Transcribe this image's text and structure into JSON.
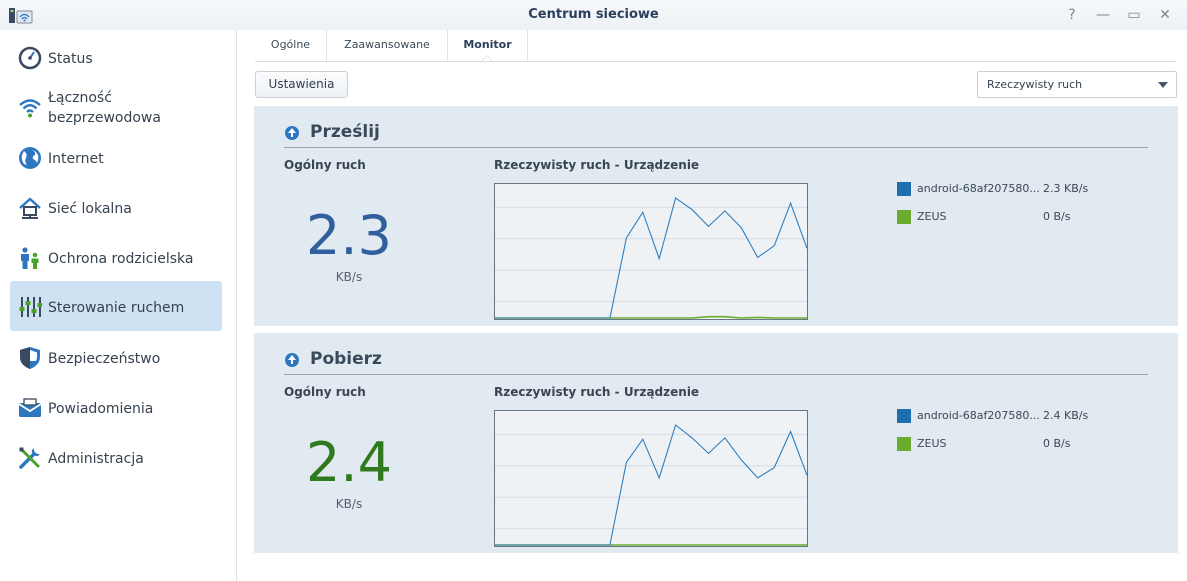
{
  "window": {
    "title": "Centrum sieciowe",
    "help_glyph": "?",
    "minimize_glyph": "—",
    "maximize_glyph": "▭",
    "close_glyph": "✕"
  },
  "sidebar": {
    "items": [
      {
        "label": "Status",
        "icon": "gauge-icon",
        "active": false
      },
      {
        "label": "Łączność\nbezprzewodowa",
        "icon": "wifi-icon",
        "active": false
      },
      {
        "label": "Internet",
        "icon": "globe-icon",
        "active": false
      },
      {
        "label": "Sieć lokalna",
        "icon": "home-network-icon",
        "active": false
      },
      {
        "label": "Ochrona rodzicielska",
        "icon": "family-icon",
        "active": false
      },
      {
        "label": "Sterowanie ruchem",
        "icon": "sliders-icon",
        "active": true
      },
      {
        "label": "Bezpieczeństwo",
        "icon": "shield-icon",
        "active": false
      },
      {
        "label": "Powiadomienia",
        "icon": "mailbox-icon",
        "active": false
      },
      {
        "label": "Administracja",
        "icon": "tools-icon",
        "active": false
      }
    ]
  },
  "tabs": [
    {
      "label": "Ogólne",
      "active": false
    },
    {
      "label": "Zaawansowane",
      "active": false
    },
    {
      "label": "Monitor",
      "active": true
    }
  ],
  "toolbar": {
    "settings_label": "Ustawienia",
    "view_select_value": "Rzeczywisty ruch"
  },
  "upload": {
    "title": "Prześlij",
    "total_label": "Ogólny ruch",
    "total_value": "2.3",
    "total_unit": "KB/s",
    "chart_label": "Rzeczywisty ruch - Urządzenie",
    "value_color": "#2f5f9c",
    "legend": [
      {
        "name": "android-68af207580...",
        "value": "2.3 KB/s",
        "color": "#1f6fb0"
      },
      {
        "name": "ZEUS",
        "value": "0 B/s",
        "color": "#6aac2f"
      }
    ]
  },
  "download": {
    "title": "Pobierz",
    "total_label": "Ogólny ruch",
    "total_value": "2.4",
    "total_unit": "KB/s",
    "chart_label": "Rzeczywisty ruch - Urządzenie",
    "value_color": "#2f7a1e",
    "legend": [
      {
        "name": "android-68af207580...",
        "value": "2.4 KB/s",
        "color": "#1f6fb0"
      },
      {
        "name": "ZEUS",
        "value": "0 B/s",
        "color": "#6aac2f"
      }
    ]
  },
  "chart_data": [
    {
      "type": "line",
      "title": "Rzeczywisty ruch - Urządzenie",
      "ylim": [
        0,
        1
      ],
      "series": [
        {
          "name": "android-68af207580...",
          "color": "#2f7fc0",
          "values": [
            0,
            0,
            0,
            0,
            0,
            0,
            0,
            0,
            0.62,
            0.82,
            0.46,
            0.93,
            0.84,
            0.71,
            0.83,
            0.7,
            0.47,
            0.56,
            0.89,
            0.54
          ]
        },
        {
          "name": "ZEUS",
          "color": "#6aac2f",
          "values": [
            0,
            0,
            0,
            0,
            0,
            0,
            0,
            0,
            0,
            0,
            0,
            0,
            0,
            0.01,
            0.01,
            0,
            0.005,
            0,
            0,
            0
          ]
        }
      ]
    },
    {
      "type": "line",
      "title": "Rzeczywisty ruch - Urządzenie",
      "ylim": [
        0,
        1
      ],
      "series": [
        {
          "name": "android-68af207580...",
          "color": "#2f7fc0",
          "values": [
            0,
            0,
            0,
            0,
            0,
            0,
            0,
            0,
            0.64,
            0.82,
            0.52,
            0.93,
            0.83,
            0.71,
            0.83,
            0.66,
            0.52,
            0.6,
            0.88,
            0.54
          ]
        },
        {
          "name": "ZEUS",
          "color": "#6aac2f",
          "values": [
            0,
            0,
            0,
            0,
            0,
            0,
            0,
            0,
            0,
            0,
            0,
            0,
            0,
            0,
            0,
            0,
            0,
            0,
            0,
            0
          ]
        }
      ]
    }
  ]
}
